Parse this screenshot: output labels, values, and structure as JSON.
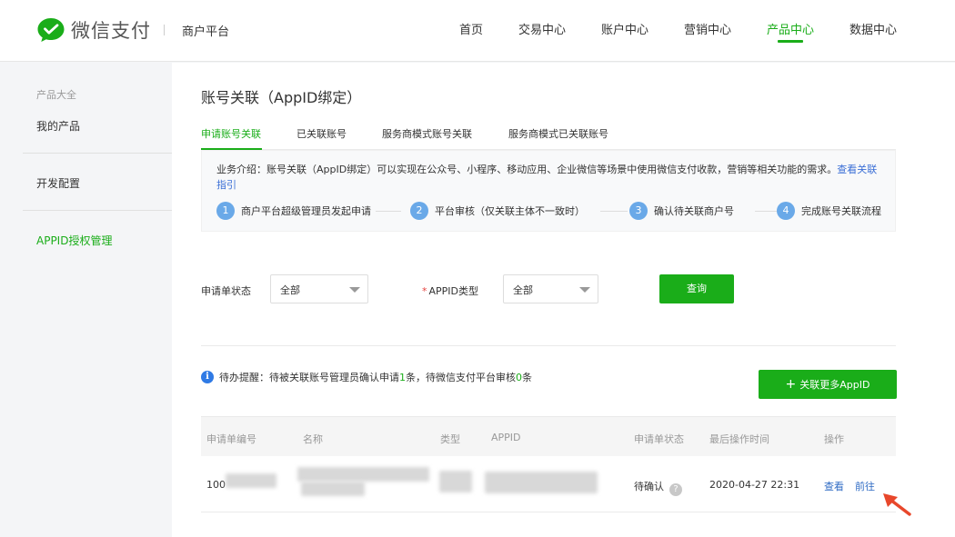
{
  "header": {
    "brand": "微信支付",
    "platform": "商户平台",
    "nav": [
      "首页",
      "交易中心",
      "账户中心",
      "营销中心",
      "产品中心",
      "数据中心"
    ],
    "active_nav": "产品中心"
  },
  "sidebar": {
    "category": "产品大全",
    "items": [
      "我的产品",
      "开发配置",
      "APPID授权管理"
    ],
    "active": "APPID授权管理"
  },
  "page": {
    "title": "账号关联（AppID绑定）",
    "tabs": [
      "申请账号关联",
      "已关联账号",
      "服务商模式账号关联",
      "服务商模式已关联账号"
    ],
    "active_tab": "申请账号关联"
  },
  "intro": {
    "text": "业务介绍：账号关联（AppID绑定）可以实现在公众号、小程序、移动应用、企业微信等场景中使用微信支付收款，营销等相关功能的需求。",
    "link": "查看关联指引",
    "steps": [
      {
        "num": "1",
        "label": "商户平台超级管理员发起申请"
      },
      {
        "num": "2",
        "label": "平台审核（仅关联主体不一致时）"
      },
      {
        "num": "3",
        "label": "确认待关联商户号"
      },
      {
        "num": "4",
        "label": "完成账号关联流程"
      }
    ]
  },
  "filters": {
    "status_label": "申请单状态",
    "status_value": "全部",
    "type_required": "*",
    "type_label": "APPID类型",
    "type_value": "全部",
    "query_button": "查询"
  },
  "notice": {
    "icon": "info-icon",
    "prefix": "待办提醒：待被关联账号管理员确认申请",
    "count1": "1",
    "middle": "条，待微信支付平台审核",
    "count2": "0",
    "suffix": "条",
    "add_button": "关联更多AppID"
  },
  "table": {
    "columns": [
      "申请单编号",
      "名称",
      "类型",
      "APPID",
      "申请单状态",
      "最后操作时间",
      "操作"
    ],
    "rows": [
      {
        "id_visible": "100",
        "status": "待确认",
        "time": "2020-04-27 22:31",
        "actions": [
          "查看",
          "前往"
        ]
      }
    ]
  },
  "colors": {
    "brand_green": "#1aad19",
    "link_blue": "#2f6bc4",
    "annotation_arrow": "#e8472b"
  }
}
